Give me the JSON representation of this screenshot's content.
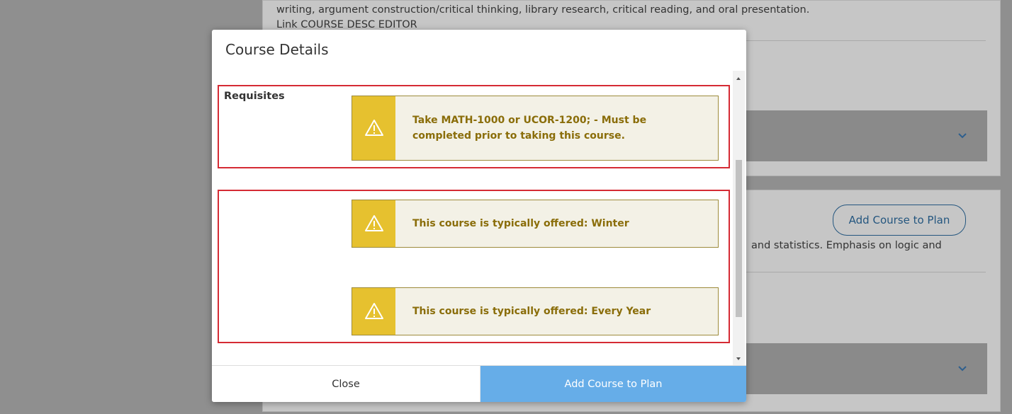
{
  "background": {
    "desc_text_line1": "writing, argument construction/critical thinking, library research, critical reading, and oral presentation.",
    "desc_text_line2": "Link COURSE DESC EDITOR",
    "second_course_text": "and statistics. Emphasis on logic and",
    "add_course_button_label": "Add Course to Plan"
  },
  "modal": {
    "title": "Course Details",
    "requisites_label": "Requisites",
    "requisite_alert": "Take MATH-1000 or UCOR-1200; - Must be\ncompleted prior to taking this course.",
    "offered_alerts": [
      "This course is typically offered: Winter",
      "This course is typically offered: Every Year"
    ],
    "close_label": "Close",
    "add_label": "Add Course to Plan"
  },
  "colors": {
    "alert_icon_bg": "#e6c12f",
    "alert_text": "#8a6d09",
    "highlight_border": "#d52b34",
    "primary_button": "#66ade8"
  },
  "icons": {
    "warning": "warning-triangle-icon",
    "chevron": "chevron-down-icon"
  }
}
